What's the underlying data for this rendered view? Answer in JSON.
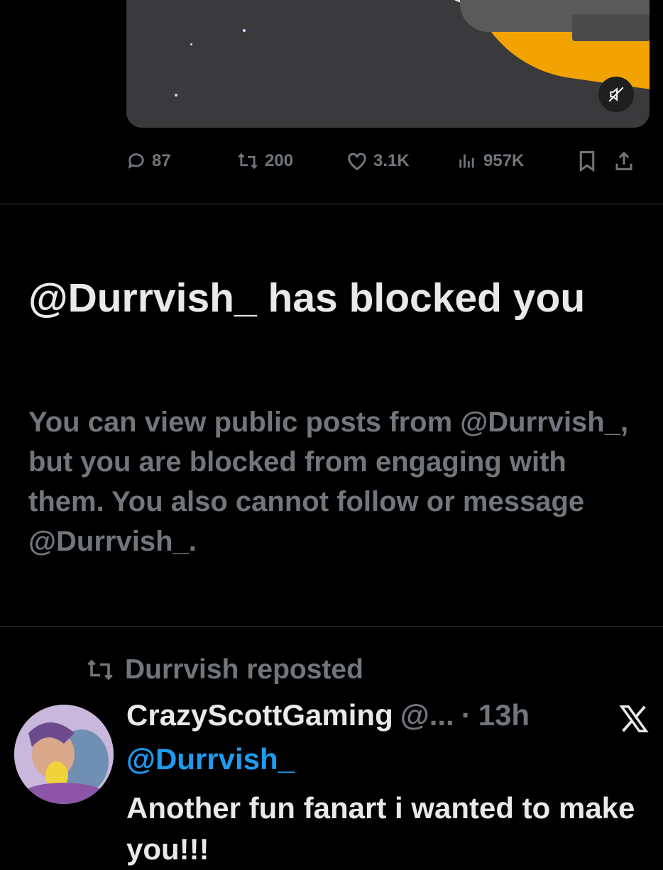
{
  "colors": {
    "background": "#000000",
    "text_primary": "#e7e9ea",
    "text_secondary": "#71767b",
    "link": "#1d9bf0",
    "divider": "#2f3336"
  },
  "media": {
    "icon": "mute-icon"
  },
  "actions": {
    "replies": "87",
    "reposts": "200",
    "likes": "3.1K",
    "views": "957K",
    "icons": [
      "reply-icon",
      "repost-icon",
      "like-icon",
      "views-icon",
      "bookmark-icon",
      "share-icon"
    ]
  },
  "blocked": {
    "title": "@Durrvish_ has blocked you",
    "body": "You can view public posts from @Durrvish_, but you are blocked from engaging with them. You also cannot follow or message @Durrvish_."
  },
  "repost": {
    "label": "Durrvish reposted",
    "author_name": "CrazyScottGaming",
    "handle": "@...",
    "separator": "·",
    "time": "13h",
    "mention": "@Durrvish_",
    "text": "Another fun fanart i wanted to make you!!!"
  }
}
